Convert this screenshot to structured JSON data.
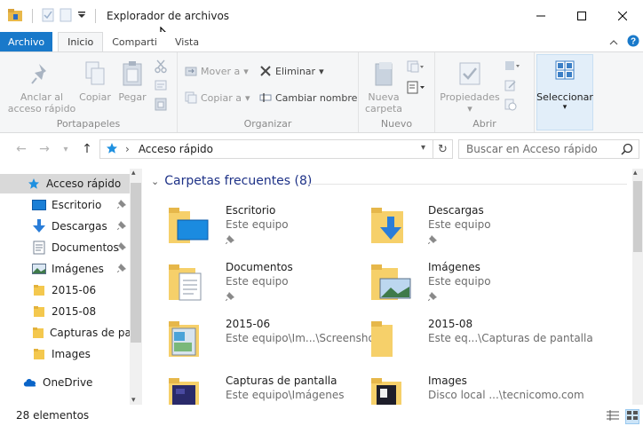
{
  "window": {
    "title": "Explorador de archivos",
    "accent": "#1979ca"
  },
  "tabs": [
    {
      "label": "Archivo"
    },
    {
      "label": "Inicio"
    },
    {
      "label": "Comparti"
    },
    {
      "label": "Vista"
    }
  ],
  "ribbon": {
    "portapapeles": {
      "label": "Portapapeles",
      "anclar": "Anclar al acceso rápido",
      "copiar": "Copiar",
      "pegar": "Pegar"
    },
    "organizar": {
      "label": "Organizar",
      "mover": "Mover a",
      "copiar_a": "Copiar a",
      "eliminar": "Eliminar",
      "cambiar_nombre": "Cambiar nombre"
    },
    "nuevo": {
      "label": "Nuevo",
      "nueva_carpeta": "Nueva carpeta"
    },
    "abrir": {
      "label": "Abrir",
      "propiedades": "Propiedades"
    },
    "seleccionar": "Seleccionar"
  },
  "address": {
    "path": "Acceso rápido",
    "search_placeholder": "Buscar en Acceso rápido"
  },
  "nav": {
    "items": [
      {
        "label": "Acceso rápido",
        "icon": "star-icon"
      },
      {
        "label": "Escritorio",
        "icon": "desktop-icon"
      },
      {
        "label": "Descargas",
        "icon": "download-icon"
      },
      {
        "label": "Documentos",
        "icon": "documents-icon"
      },
      {
        "label": "Imágenes",
        "icon": "pictures-icon"
      },
      {
        "label": "2015-06",
        "icon": "folder-icon"
      },
      {
        "label": "2015-08",
        "icon": "folder-icon"
      },
      {
        "label": "Capturas de pan",
        "icon": "folder-icon"
      },
      {
        "label": "Images",
        "icon": "folder-icon"
      },
      {
        "label": "OneDrive",
        "icon": "cloud-icon"
      }
    ]
  },
  "content": {
    "group_title": "Carpetas frecuentes (8)",
    "tiles": [
      {
        "name": "Escritorio",
        "sub": "Este equipo",
        "icon": "desktop-folder-icon"
      },
      {
        "name": "Descargas",
        "sub": "Este equipo",
        "icon": "download-folder-icon"
      },
      {
        "name": "Documentos",
        "sub": "Este equipo",
        "icon": "documents-folder-icon"
      },
      {
        "name": "Imágenes",
        "sub": "Este equipo",
        "icon": "pictures-folder-icon"
      },
      {
        "name": "2015-06",
        "sub": "Este equipo\\Im...\\Screenshots",
        "icon": "folder-icon"
      },
      {
        "name": "2015-08",
        "sub": "Este eq...\\Capturas de pantalla",
        "icon": "folder-icon"
      },
      {
        "name": "Capturas de pantalla",
        "sub": "Este equipo\\Imágenes",
        "icon": "folder-icon"
      },
      {
        "name": "Images",
        "sub": "Disco local ...\\tecnicomo.com",
        "icon": "folder-icon"
      }
    ]
  },
  "status": {
    "count": "28 elementos"
  }
}
